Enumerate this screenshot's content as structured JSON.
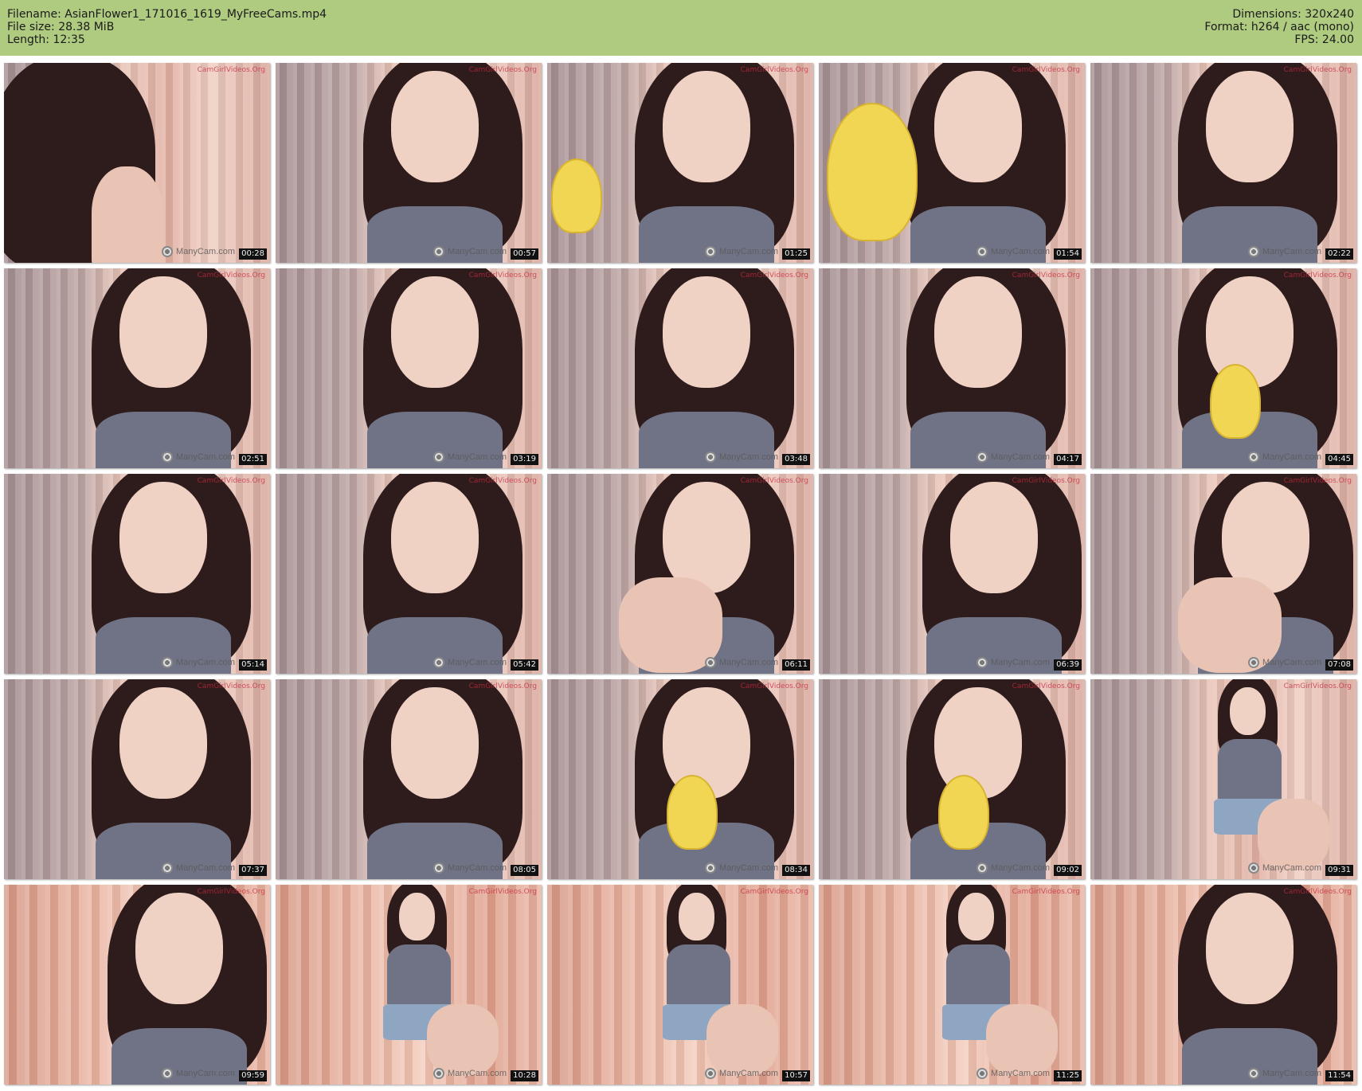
{
  "header": {
    "filename_line": "Filename: AsianFlower1_171016_1619_MyFreeCams.mp4",
    "filesize_line": "File size: 28.38 MiB",
    "length_line": "Length: 12:35",
    "dimensions_line": "Dimensions: 320x240",
    "format_line": "Format: h264 / aac (mono)",
    "fps_line": "FPS: 24.00",
    "bg_color": "#afcb80"
  },
  "watermarks": {
    "site": "CamGirlVideos.Org",
    "cam": "ManyCam.com"
  },
  "frames": [
    {
      "time": "00:28",
      "scene": "back-of-head"
    },
    {
      "time": "00:57",
      "scene": "smile"
    },
    {
      "time": "01:25",
      "scene": "banana"
    },
    {
      "time": "01:54",
      "scene": "banana-large"
    },
    {
      "time": "02:22",
      "scene": "smile"
    },
    {
      "time": "02:51",
      "scene": "portrait"
    },
    {
      "time": "03:19",
      "scene": "smile"
    },
    {
      "time": "03:48",
      "scene": "smile"
    },
    {
      "time": "04:17",
      "scene": "smile"
    },
    {
      "time": "04:45",
      "scene": "banana-eat"
    },
    {
      "time": "05:14",
      "scene": "portrait"
    },
    {
      "time": "05:42",
      "scene": "portrait"
    },
    {
      "time": "06:11",
      "scene": "knee"
    },
    {
      "time": "06:39",
      "scene": "lean"
    },
    {
      "time": "07:08",
      "scene": "arm"
    },
    {
      "time": "07:37",
      "scene": "portrait"
    },
    {
      "time": "08:05",
      "scene": "portrait"
    },
    {
      "time": "08:34",
      "scene": "banana-eat"
    },
    {
      "time": "09:02",
      "scene": "banana-eat"
    },
    {
      "time": "09:31",
      "scene": "standing"
    },
    {
      "time": "09:59",
      "scene": "lean"
    },
    {
      "time": "10:28",
      "scene": "full-body"
    },
    {
      "time": "10:57",
      "scene": "full-body"
    },
    {
      "time": "11:25",
      "scene": "full-body"
    },
    {
      "time": "11:54",
      "scene": "smile"
    }
  ]
}
